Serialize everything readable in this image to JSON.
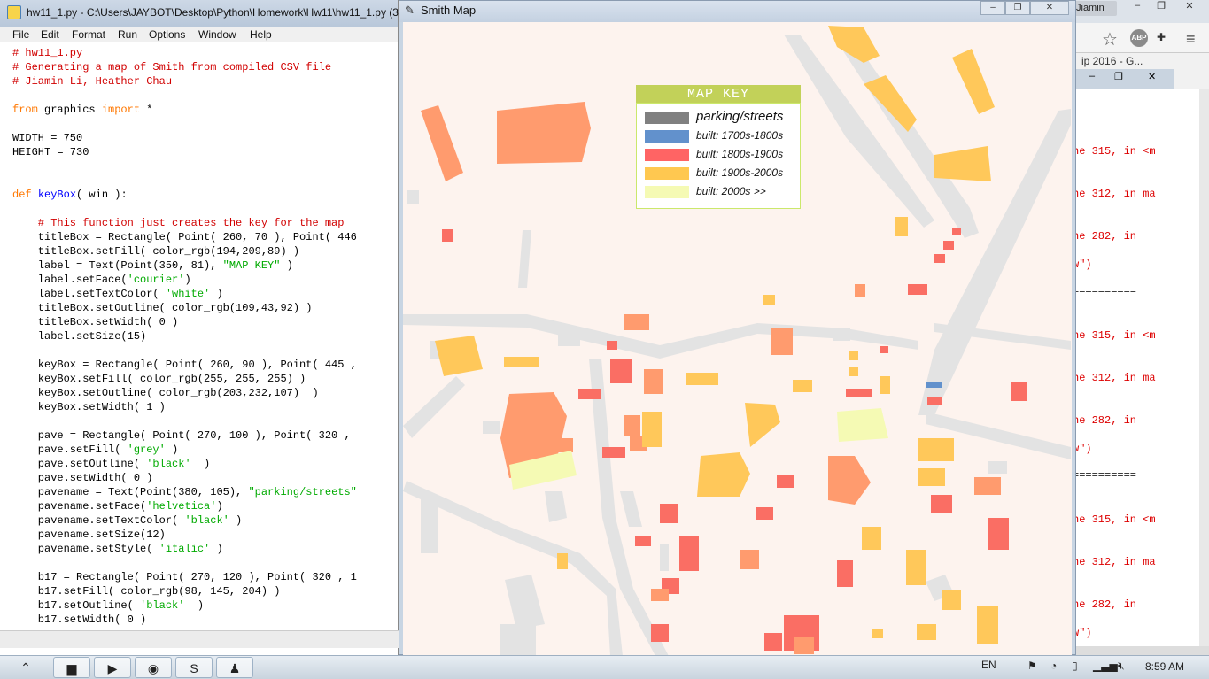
{
  "idle": {
    "title": "hw11_1.py - C:\\Users\\JAYBOT\\Desktop\\Python\\Homework\\Hw11\\hw11_1.py (3",
    "menu": [
      "File",
      "Edit",
      "Format",
      "Run",
      "Options",
      "Window",
      "Help"
    ],
    "code": {
      "l1": "# hw11_1.py",
      "l2": "# Generating a map of Smith from compiled CSV file",
      "l3": "# Jiamin Li, Heather Chau",
      "l5a": "from",
      "l5b": " graphics ",
      "l5c": "import",
      "l5d": " *",
      "l7": "WIDTH = 750",
      "l8": "HEIGHT = 730",
      "l11a": "def",
      "l11b": " ",
      "l11c": "keyBox",
      "l11d": "( win ):",
      "l13": "    # This function just creates the key for the map",
      "l14": "    titleBox = Rectangle( Point( 260, 70 ), Point( 446",
      "l15": "    titleBox.setFill( color_rgb(194,209,89) )",
      "l16a": "    label = Text(Point(350, 81), ",
      "l16b": "\"MAP KEY\"",
      "l16c": " )",
      "l17a": "    label.setFace(",
      "l17b": "'courier'",
      "l17c": ")",
      "l18a": "    label.setTextColor( ",
      "l18b": "'white'",
      "l18c": " )",
      "l19": "    titleBox.setOutline( color_rgb(109,43,92) )",
      "l20": "    titleBox.setWidth( 0 )",
      "l21": "    label.setSize(15)",
      "l23": "    keyBox = Rectangle( Point( 260, 90 ), Point( 445 ,",
      "l24": "    keyBox.setFill( color_rgb(255, 255, 255) )",
      "l25": "    keyBox.setOutline( color_rgb(203,232,107)  )",
      "l26": "    keyBox.setWidth( 1 )",
      "l28": "    pave = Rectangle( Point( 270, 100 ), Point( 320 ,",
      "l29a": "    pave.setFill( ",
      "l29b": "'grey'",
      "l29c": " )",
      "l30a": "    pave.setOutline( ",
      "l30b": "'black'",
      "l30c": "  )",
      "l31": "    pave.setWidth( 0 )",
      "l32a": "    pavename = Text(Point(380, 105), ",
      "l32b": "\"parking/streets\"",
      "l33a": "    pavename.setFace(",
      "l33b": "'helvetica'",
      "l33c": ")",
      "l34a": "    pavename.setTextColor( ",
      "l34b": "'black'",
      "l34c": " )",
      "l35": "    pavename.setSize(12)",
      "l36a": "    pavename.setStyle( ",
      "l36b": "'italic'",
      "l36c": " )",
      "l38": "    b17 = Rectangle( Point( 270, 120 ), Point( 320 , 1",
      "l39": "    b17.setFill( color_rgb(98, 145, 204) )",
      "l40a": "    b17.setOutline( ",
      "l40b": "'black'",
      "l40c": "  )",
      "l41": "    b17.setWidth( 0 )"
    }
  },
  "mapwin": {
    "title": "Smith Map",
    "key": {
      "title": "MAP KEY",
      "items": [
        {
          "label": "parking/streets",
          "color": "#808080"
        },
        {
          "label": "built: 1700s-1800s",
          "color": "#6291cc"
        },
        {
          "label": "built: 1800s-1900s",
          "color": "#ff6464"
        },
        {
          "label": "built: 1900s-2000s",
          "color": "#ffc850"
        },
        {
          "label": "built: 2000s >>",
          "color": "#f5fab4"
        }
      ]
    }
  },
  "browser": {
    "profile": "Jiamin",
    "tab_text": "ip 2016 - G...",
    "lines": [
      {
        "text": "he 315, in <m",
        "dark": false
      },
      {
        "text": "he 312, in ma",
        "dark": false
      },
      {
        "text": "he 282, in",
        "dark": false
      },
      {
        "text": "w\")",
        "dark": false
      },
      {
        "text": "==========",
        "dark": true
      },
      {
        "text": "he 315, in <m",
        "dark": false
      },
      {
        "text": "he 312, in ma",
        "dark": false
      },
      {
        "text": "he 282, in",
        "dark": false
      },
      {
        "text": "w\")",
        "dark": false
      },
      {
        "text": "==========",
        "dark": true
      },
      {
        "text": "he 315, in <m",
        "dark": false
      },
      {
        "text": "he 312, in ma",
        "dark": false
      },
      {
        "text": "he 282, in",
        "dark": false
      },
      {
        "text": "w\")",
        "dark": false
      }
    ]
  },
  "taskbar": {
    "lang": "EN",
    "time": "8:59 AM"
  }
}
